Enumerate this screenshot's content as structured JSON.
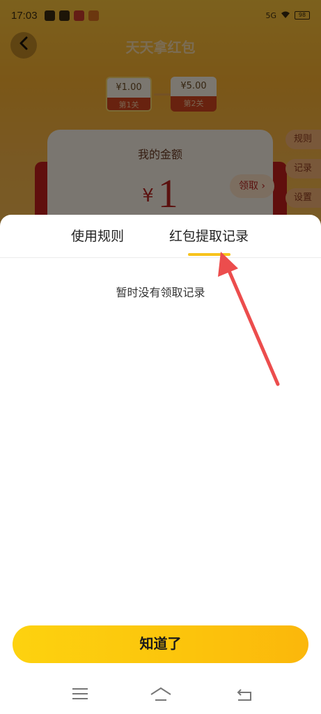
{
  "status_bar": {
    "time": "17:03",
    "signal": "5G",
    "battery": "98"
  },
  "background_page": {
    "title": "天天拿红包",
    "stages": [
      {
        "amount": "¥1.00",
        "level": "第1关"
      },
      {
        "amount": "¥5.00",
        "level": "第2关"
      }
    ],
    "card_title": "我的金额",
    "currency_symbol": "¥",
    "amount_value": "1",
    "claim_label": "领取 ›",
    "side_buttons": [
      "规则",
      "记录",
      "设置"
    ]
  },
  "sheet": {
    "tabs": [
      {
        "label": "使用规则",
        "active": false
      },
      {
        "label": "红包提取记录",
        "active": true
      }
    ],
    "empty_message": "暂时没有领取记录",
    "confirm_label": "知道了"
  },
  "colors": {
    "accent_yellow": "#fcc40c",
    "annotation_arrow": "#ec4d4d",
    "tab_indicator": "#f7c31c"
  },
  "icons": {
    "back": "chevron-left-icon",
    "nav_menu": "menu-icon",
    "nav_home": "home-icon",
    "nav_back": "back-icon"
  }
}
